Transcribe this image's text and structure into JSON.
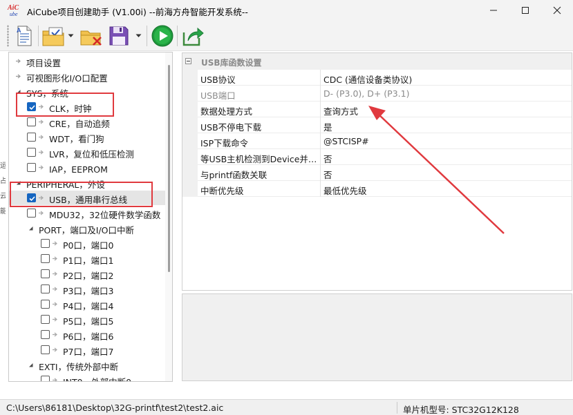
{
  "window": {
    "logo_text": "AiCube",
    "title": "AiCube项目创建助手 (V1.00i) --前海方舟智能开发系统--"
  },
  "toolbar": {
    "buttons": [
      "new-file-icon",
      "config-icon",
      "close-project-icon",
      "save-icon",
      "run-icon",
      "export-icon"
    ]
  },
  "tree": {
    "items": [
      {
        "label": "项目设置",
        "level": 0,
        "checkbox": false,
        "expander": "arrow"
      },
      {
        "label": "可视图形化I/O口配置",
        "level": 0,
        "checkbox": false,
        "expander": "arrow"
      },
      {
        "label": "SYS，系统",
        "level": 0,
        "checkbox": false,
        "expander": "triangle"
      },
      {
        "label": "CLK，时钟",
        "level": 1,
        "checkbox": true,
        "checked": true
      },
      {
        "label": "CRE，自动追频",
        "level": 1,
        "checkbox": true,
        "checked": false
      },
      {
        "label": "WDT，看门狗",
        "level": 1,
        "checkbox": true,
        "checked": false
      },
      {
        "label": "LVR，复位和低压检测",
        "level": 1,
        "checkbox": true,
        "checked": false
      },
      {
        "label": "IAP，EEPROM",
        "level": 1,
        "checkbox": true,
        "checked": false
      },
      {
        "label": "PERIPHERAL，外设",
        "level": 0,
        "checkbox": false,
        "expander": "triangle"
      },
      {
        "label": "USB，通用串行总线",
        "level": 1,
        "checkbox": true,
        "checked": true,
        "selected": true
      },
      {
        "label": "MDU32，32位硬件数学函数",
        "level": 1,
        "checkbox": true,
        "checked": false
      },
      {
        "label": "PORT，端口及I/O口中断",
        "level": 1,
        "checkbox": false,
        "expander": "triangle"
      },
      {
        "label": "P0口，端口0",
        "level": 2,
        "checkbox": true,
        "checked": false
      },
      {
        "label": "P1口，端口1",
        "level": 2,
        "checkbox": true,
        "checked": false
      },
      {
        "label": "P2口，端口2",
        "level": 2,
        "checkbox": true,
        "checked": false
      },
      {
        "label": "P3口，端口3",
        "level": 2,
        "checkbox": true,
        "checked": false
      },
      {
        "label": "P4口，端口4",
        "level": 2,
        "checkbox": true,
        "checked": false
      },
      {
        "label": "P5口，端口5",
        "level": 2,
        "checkbox": true,
        "checked": false
      },
      {
        "label": "P6口，端口6",
        "level": 2,
        "checkbox": true,
        "checked": false
      },
      {
        "label": "P7口，端口7",
        "level": 2,
        "checkbox": true,
        "checked": false
      },
      {
        "label": "EXTI，传统外部中断",
        "level": 1,
        "checkbox": false,
        "expander": "triangle"
      },
      {
        "label": "INT0，外部中断0",
        "level": 2,
        "checkbox": true,
        "checked": false
      }
    ]
  },
  "left_strip": [
    "运",
    "占",
    "云",
    "能"
  ],
  "property_grid": {
    "category": "USB库函数设置",
    "rows": [
      {
        "key": "USB协议",
        "value": "CDC (通信设备类协议)",
        "dim": false
      },
      {
        "key": "USB端口",
        "value": "D- (P3.0), D+ (P3.1)",
        "dim": true
      },
      {
        "key": "数据处理方式",
        "value": "查询方式",
        "dim": false
      },
      {
        "key": "USB不停电下载",
        "value": "是",
        "dim": false
      },
      {
        "key": "ISP下载命令",
        "value": "@STCISP#",
        "dim": false
      },
      {
        "key": "等USB主机检测到Device并…",
        "value": "否",
        "dim": false
      },
      {
        "key": "与printf函数关联",
        "value": "否",
        "dim": false
      },
      {
        "key": "中断优先级",
        "value": "最低优先级",
        "dim": false
      }
    ]
  },
  "statusbar": {
    "path": "C:\\Users\\86181\\Desktop\\32G-printf\\test2\\test2.aic",
    "model": "单片机型号:  STC32G12K128"
  },
  "colors": {
    "annotation_red": "#e0393e",
    "checkbox_blue": "#1565c0",
    "run_green": "#1e9a3c"
  }
}
